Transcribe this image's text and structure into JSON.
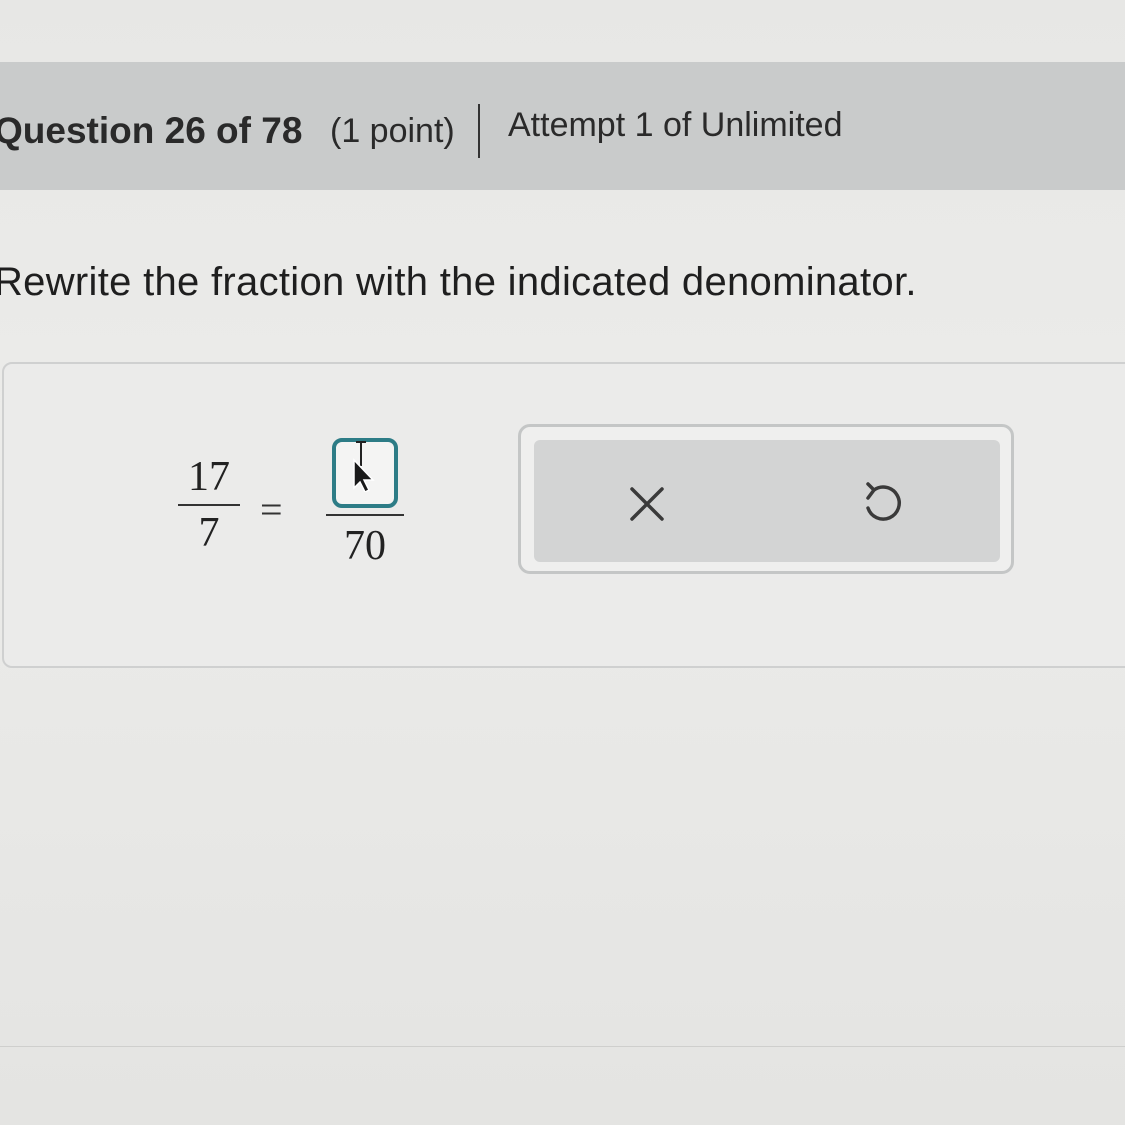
{
  "header": {
    "question_label": "Question 26 of 78",
    "points_label": "(1 point)",
    "attempt_label": "Attempt 1 of Unlimited"
  },
  "question": {
    "instruction": "Rewrite the fraction with the indicated denominator."
  },
  "equation": {
    "left_numerator": "17",
    "left_denominator": "7",
    "equals_sign": "=",
    "answer_value": "",
    "right_denominator": "70"
  },
  "tools": {
    "clear_icon": "close-icon",
    "undo_icon": "undo-icon"
  },
  "colors": {
    "header_bg": "#c9cbcb",
    "answer_box_border": "#2d7c86",
    "tools_panel_bg": "#d3d4d4"
  }
}
